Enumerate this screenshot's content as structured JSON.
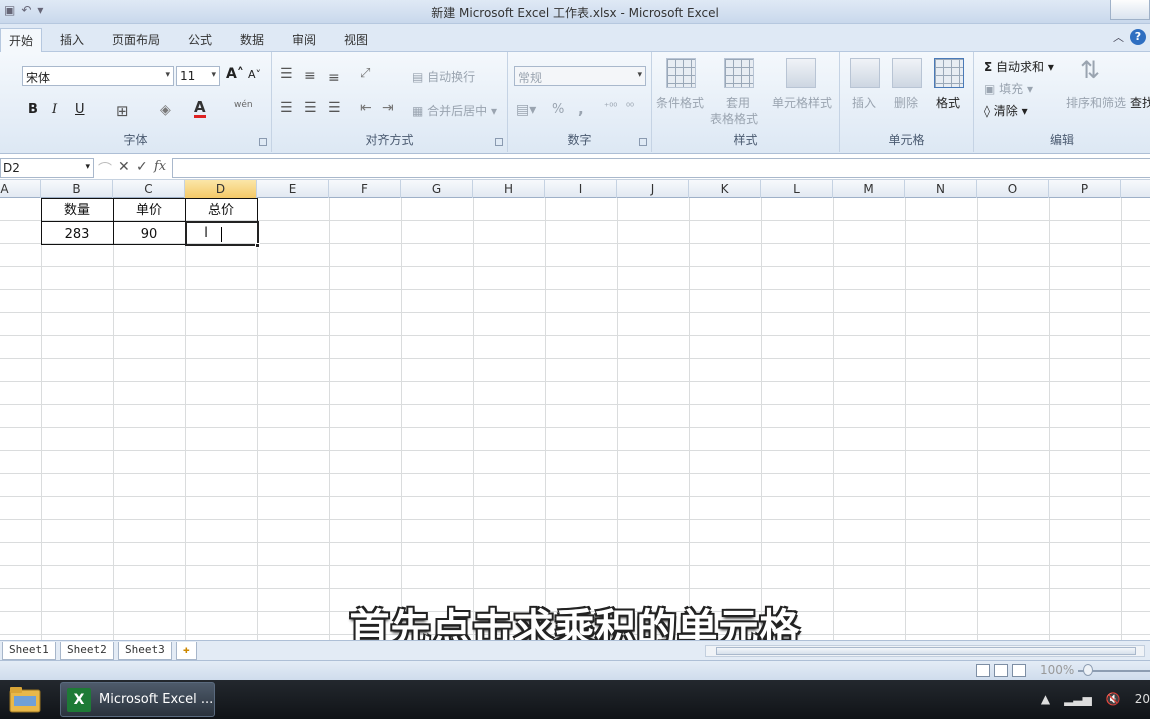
{
  "window": {
    "title": "新建 Microsoft Excel 工作表.xlsx - Microsoft Excel"
  },
  "tabs": [
    "开始",
    "插入",
    "页面布局",
    "公式",
    "数据",
    "审阅",
    "视图"
  ],
  "ribbon": {
    "font": {
      "name": "宋体",
      "size": "11",
      "bold": "B",
      "italic": "I",
      "underline": "U",
      "grow": "A",
      "shrink": "A",
      "color_a": "A",
      "phonetic": "wén",
      "label": "字体"
    },
    "alignment": {
      "wrap": "自动换行",
      "merge": "合并后居中",
      "label": "对齐方式"
    },
    "number": {
      "format": "常规",
      "percent": "%",
      "comma": ",",
      "label": "数字"
    },
    "styles": {
      "conditional": "条件格式",
      "table_line1": "套用",
      "table_line2": "表格格式",
      "cell_styles": "单元格样式",
      "label": "样式"
    },
    "cells": {
      "insert": "插入",
      "delete": "删除",
      "format": "格式",
      "label": "单元格"
    },
    "editing": {
      "autosum": "自动求和",
      "fill": "填充",
      "clear": "清除",
      "sort": "排序和筛选",
      "find": "查找",
      "label": "编辑"
    }
  },
  "formula_bar": {
    "name_box": "D2",
    "cancel": "✕",
    "enter": "✓",
    "fx": "fx",
    "value": ""
  },
  "columns": [
    "A",
    "B",
    "C",
    "D",
    "E",
    "F",
    "G",
    "H",
    "I",
    "J",
    "K",
    "L",
    "M",
    "N",
    "O",
    "P"
  ],
  "selected_column": "D",
  "cells": {
    "B1": "数量",
    "C1": "单价",
    "D1": "总价",
    "B2": "283",
    "C2": "90",
    "D2": ""
  },
  "subtitle": "首先点击求乘积的单元格",
  "sheets": [
    "Sheet1",
    "Sheet2",
    "Sheet3"
  ],
  "status": {
    "zoom": "100%"
  },
  "taskbar": {
    "app": "Microsoft Excel ...",
    "clock": "20"
  },
  "colors": {
    "selection_header": "#f4c968",
    "ribbon_bg": "#dde8f4",
    "excel_green": "#1e7a36"
  }
}
